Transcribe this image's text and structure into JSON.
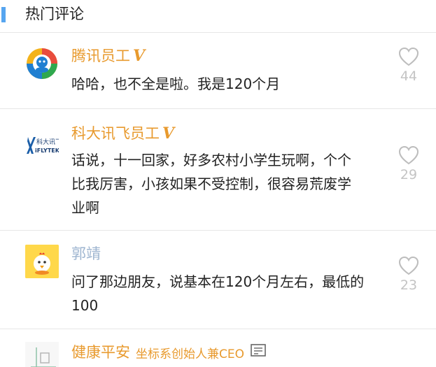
{
  "section": {
    "title": "热门评论",
    "accent_color": "#56a5f0"
  },
  "comments": [
    {
      "author": "腾讯员工",
      "verified_badge": "V",
      "avatar_icon": "tencent-news-logo-icon",
      "text": "哈哈，也不全是啦。我是120个月",
      "likes": "44"
    },
    {
      "author": "科大讯飞员工",
      "verified_badge": "V",
      "avatar_icon": "iflytek-logo-icon",
      "avatar_logo_cn": "科大讯飞",
      "avatar_logo_en": "iFLYTEK",
      "text": "话说，十一回家，好多农村小学生玩啊，个个比我厉害，小孩如果不受控制，很容易荒废学业啊",
      "likes": "29"
    },
    {
      "author": "郭靖",
      "avatar_icon": "chicken-cartoon-icon",
      "text": "问了那边朋友，说基本在120个月左右，最低的100",
      "likes": "23"
    },
    {
      "author": "健康平安",
      "title": "坐标系创始人兼CEO",
      "avatar_icon": "grid-logo-icon",
      "action_icon": "document-icon"
    }
  ],
  "colors": {
    "author_name": "#e89a2e",
    "author_name_plain": "#9eb5d0",
    "like_count": "#c4c4c4",
    "divider": "#e6e6e6"
  }
}
